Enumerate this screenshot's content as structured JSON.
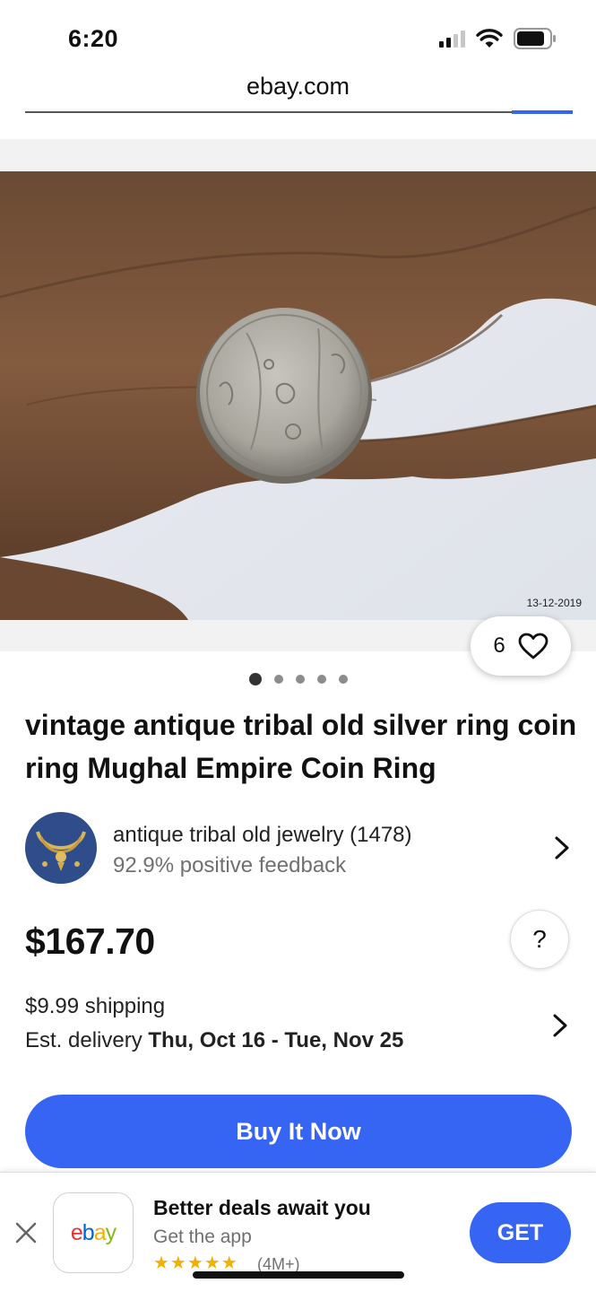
{
  "status_bar": {
    "time": "6:20",
    "icons": [
      "signal-icon",
      "wifi-icon",
      "battery-icon"
    ]
  },
  "browser": {
    "url": "ebay.com"
  },
  "product": {
    "image": {
      "description_icon": "coin-ring-photo",
      "date_stamp": "13-12-2019"
    },
    "watch_count": "6",
    "carousel_dots": 5,
    "carousel_active": 0,
    "title": "vintage antique tribal old silver ring coin ring Mughal Empire Coin Ring",
    "price": "$167.70",
    "help_label": "?"
  },
  "seller": {
    "name": "antique tribal old jewelry (1478)",
    "feedback": "92.9% positive feedback"
  },
  "shipping": {
    "cost": "$9.99 shipping",
    "delivery_label": "Est. delivery ",
    "delivery_dates": "Thu, Oct 16 - Tue, Nov 25"
  },
  "actions": {
    "buy_now": "Buy It Now"
  },
  "app_banner": {
    "logo": "ebay",
    "title": "Better deals await you",
    "subtitle": "Get the app",
    "stars": "★★★★★",
    "rating_count": "(4M+)",
    "get_label": "GET"
  },
  "colors": {
    "accent_blue": "#3665f3",
    "star_yellow": "#f5af02",
    "ebay_red": "#e53238",
    "ebay_blue": "#0064d2",
    "ebay_yellow": "#f5af02",
    "ebay_green": "#86b817"
  }
}
